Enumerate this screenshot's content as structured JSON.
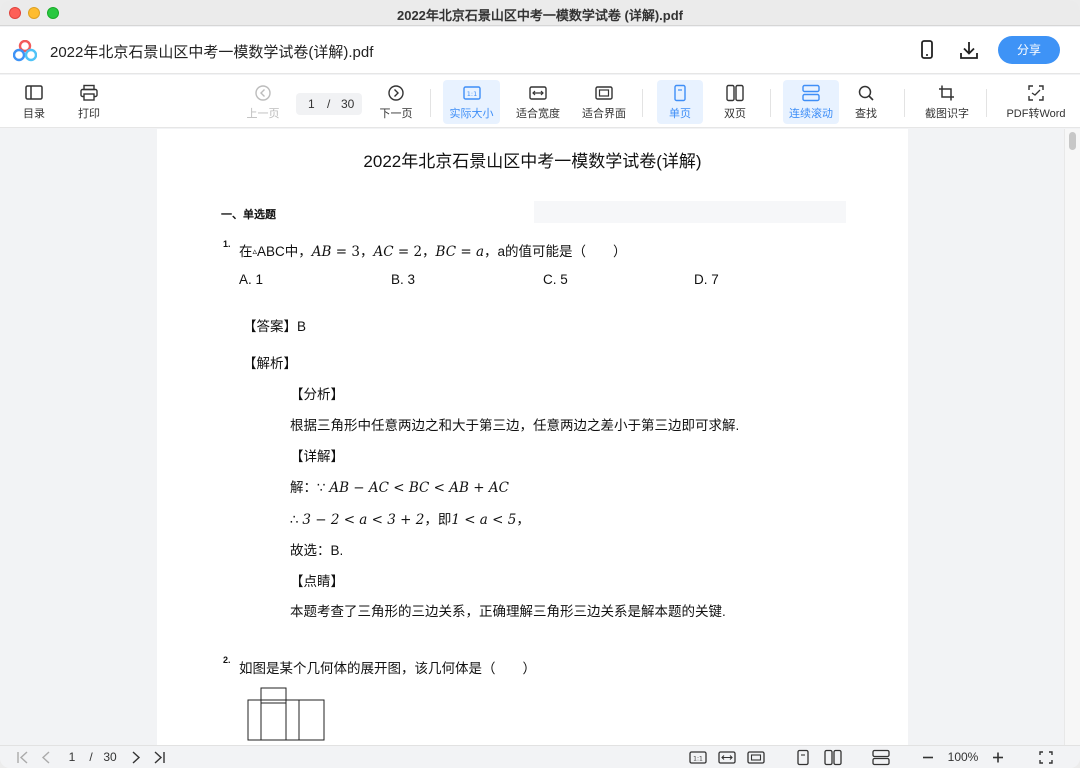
{
  "window": {
    "title": "2022年北京石景山区中考一模数学试卷 (详解).pdf"
  },
  "header": {
    "file_name": "2022年北京石景山区中考一模数学试卷(详解).pdf",
    "share_label": "分享",
    "icons": [
      "app-logo-icon",
      "phone-icon",
      "download-icon"
    ]
  },
  "toolbar": {
    "toc": "目录",
    "print": "打印",
    "prev_page": "上一页",
    "current_page": "1",
    "page_sep": "/",
    "total_pages": "30",
    "next_page": "下一页",
    "actual_size": "实际大小",
    "actual_size_glyph": "1:1",
    "fit_width": "适合宽度",
    "fit_page": "适合界面",
    "single_page": "单页",
    "double_page": "双页",
    "continuous_scroll": "连续滚动",
    "find": "查找",
    "ocr": "截图识字",
    "pdf_to_word": "PDF转Word"
  },
  "document": {
    "title": "2022年北京石景山区中考一模数学试卷(详解)",
    "section": "一、单选题",
    "q1": {
      "num": "1.",
      "prefix": "在",
      "triangle": "▵",
      "tri_name": "ABC中，",
      "ab": "AB",
      "eq3": " = 3，",
      "ac": "AC",
      "eq2": " = 2，",
      "bc": "BC",
      "eq": " = ",
      "a": "a",
      "suffix": "，a的值可能是（　　）",
      "options": [
        "A. 1",
        "B. 3",
        "C. 5",
        "D. 7"
      ],
      "answer": "【答案】B",
      "analysis_h": "【解析】",
      "fenxi_h": "【分析】",
      "fenxi": "根据三角形中任意两边之和大于第三边，任意两边之差小于第三边即可求解.",
      "xiangjie_h": "【详解】",
      "jie_prefix": "解：∵ ",
      "jie_expr": "AB − AC < BC < AB + AC",
      "so_prefix": "∴ ",
      "so_expr": "3 − 2 < a < 3 + 2",
      "so_mid": "，即",
      "so_expr2": "1 < a < 5",
      "so_end": "，",
      "choose": "故选：B.",
      "dianjing_h": "【点睛】",
      "dianjing": "本题考查了三角形的三边关系，正确理解三角形三边关系是解本题的关键."
    },
    "q2": {
      "num": "2.",
      "text": "如图是某个几何体的展开图，该几何体是（　　）"
    }
  },
  "statusbar": {
    "current_page": "1",
    "page_sep": "/",
    "total_pages": "30",
    "zoom": "100%",
    "actual_size_glyph": "1:1"
  },
  "colors": {
    "accent": "#3e93f6",
    "active_bg": "#e8f2ff",
    "close": "#fe5f57",
    "minimize": "#febc2e",
    "maximize": "#28c840"
  }
}
